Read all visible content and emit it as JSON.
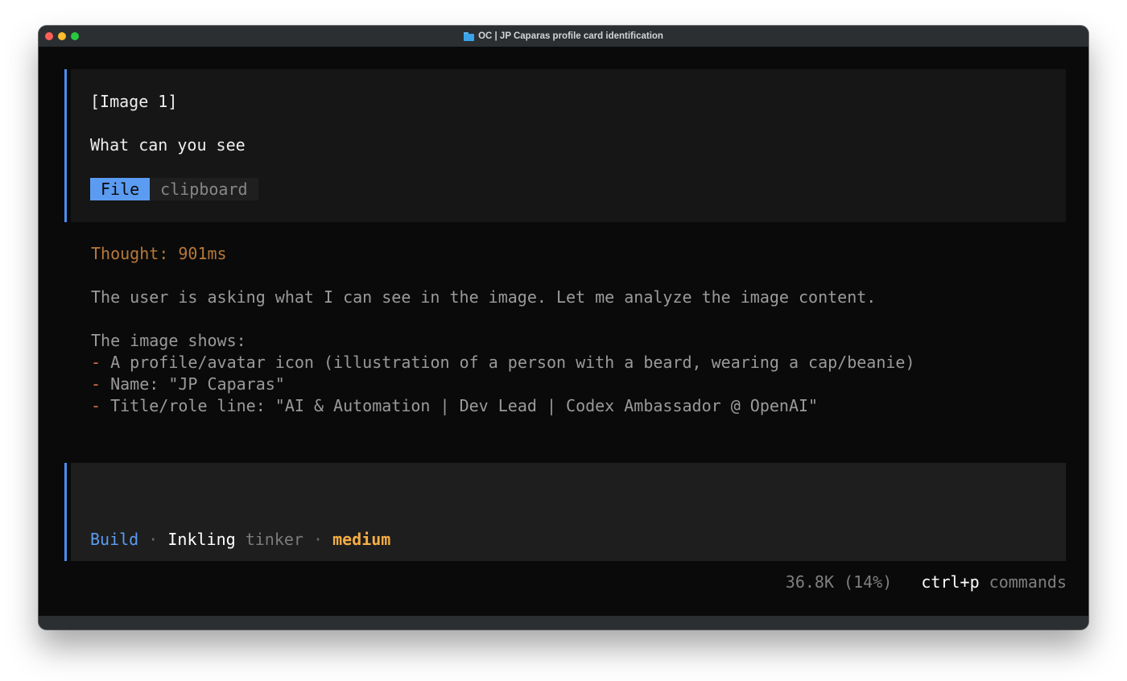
{
  "window": {
    "title": "OC | JP Caparas profile card identification",
    "title_icon": "folder-icon"
  },
  "user_message": {
    "image_tag": "[Image 1]",
    "prompt": "What can you see",
    "attachment": {
      "file_label": "File",
      "source_label": "clipboard"
    }
  },
  "assistant": {
    "thought": "Thought: 901ms",
    "intro": "The user is asking what I can see in the image. Let me analyze the image content.",
    "shows_heading": "The image shows:",
    "bullets": [
      "A profile/avatar icon (illustration of a person with a beard, wearing a cap/beanie)",
      "Name: \"JP Caparas\"",
      "Title/role line: \"AI & Automation | Dev Lead | Codex Ambassador @ OpenAI\""
    ]
  },
  "input": {
    "mode": "Build",
    "separator": "·",
    "model": "Inkling",
    "model_variant": "tinker",
    "effort": "medium"
  },
  "status": {
    "tokens": "36.8K (14%)",
    "shortcut_key": "ctrl+p",
    "shortcut_label": "commands"
  },
  "colors": {
    "accent_blue": "#4b8ef0",
    "thought": "#b8783a",
    "bullet": "#d8753d",
    "effort": "#f4ad45"
  }
}
